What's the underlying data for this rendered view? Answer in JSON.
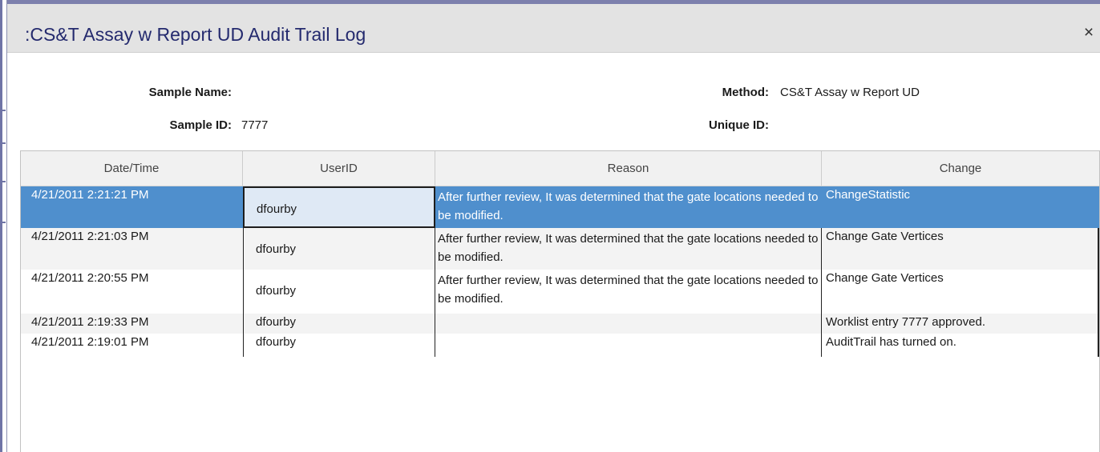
{
  "window": {
    "title": ":CS&T Assay w Report UD Audit Trail Log",
    "close_glyph": "×"
  },
  "info": {
    "sample_name_label": "Sample Name:",
    "sample_name_value": "",
    "sample_id_label": "Sample ID:",
    "sample_id_value": "7777",
    "method_label": "Method:",
    "method_value": "CS&T Assay w Report UD",
    "unique_id_label": "Unique ID:",
    "unique_id_value": ""
  },
  "grid": {
    "columns": [
      "Date/Time",
      "UserID",
      "Reason",
      "Change"
    ],
    "rows": [
      {
        "datetime": "4/21/2011 2:21:21 PM",
        "user": "dfourby",
        "reason": "After further review, It was determined that the gate locations needed to be modified.",
        "change": "ChangeStatistic",
        "selected": true
      },
      {
        "datetime": "4/21/2011 2:21:03 PM",
        "user": "dfourby",
        "reason": "After further review, It was determined that the gate locations needed to be modified.",
        "change": "Change Gate Vertices",
        "selected": false
      },
      {
        "datetime": "4/21/2011 2:20:55 PM",
        "user": "dfourby",
        "reason": "After further review, It was determined that the gate locations needed to be modified.",
        "change": "Change Gate Vertices",
        "selected": false
      },
      {
        "datetime": "4/21/2011 2:19:33 PM",
        "user": "dfourby",
        "reason": "",
        "change": "Worklist entry 7777 approved.",
        "selected": false
      },
      {
        "datetime": "4/21/2011 2:19:01 PM",
        "user": "dfourby",
        "reason": "",
        "change": "AuditTrail has turned on.",
        "selected": false
      }
    ]
  },
  "colors": {
    "title_text": "#242a6e",
    "selection": "#4f8fcd",
    "window_frame": "#7d80ad"
  }
}
